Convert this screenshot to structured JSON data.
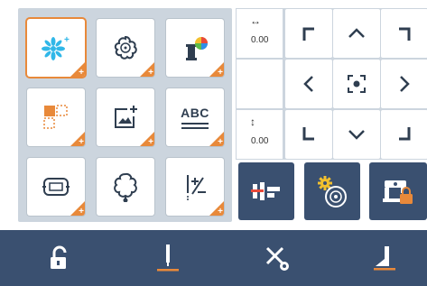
{
  "tools": [
    {
      "name": "embroidery-pattern-button",
      "icon": "sparkle-pattern-icon",
      "selected": true
    },
    {
      "name": "flower-frame-button",
      "icon": "flower-frame-icon"
    },
    {
      "name": "thread-color-button",
      "icon": "thread-color-icon"
    },
    {
      "name": "layout-select-button",
      "icon": "layout-select-icon"
    },
    {
      "name": "image-add-button",
      "icon": "image-add-icon"
    },
    {
      "name": "text-abc-button",
      "icon": "text-abc-icon",
      "label": "ABC"
    },
    {
      "name": "hoop-button",
      "icon": "hoop-icon"
    },
    {
      "name": "outline-shape-button",
      "icon": "outline-shape-icon"
    },
    {
      "name": "stitch-plus-minus-button",
      "icon": "stitch-plus-minus-icon"
    }
  ],
  "corner_symbol": "+",
  "position": {
    "horizontal_arrow": "↔",
    "horizontal_value": "0.00",
    "vertical_arrow": "↕",
    "vertical_value": "0.00"
  },
  "move_pad": {
    "up_left": "up-left-corner-icon",
    "up": "chevron-up-icon",
    "up_right": "up-right-corner-icon",
    "left": "chevron-left-icon",
    "center": "center-target-icon",
    "right": "chevron-right-icon",
    "down_left": "down-left-corner-icon",
    "down": "chevron-down-icon",
    "down_right": "down-right-corner-icon"
  },
  "modes": [
    {
      "name": "stitch-mode-button",
      "icon": "stitch-mode-icon",
      "active": true
    },
    {
      "name": "embroidery-settings-button",
      "icon": "settings-flower-icon"
    },
    {
      "name": "machine-lock-button",
      "icon": "machine-lock-icon"
    }
  ],
  "bottom_bar": [
    "unlock-icon",
    "needle-position-icon",
    "thread-cut-icon",
    "presser-foot-icon"
  ],
  "colors": {
    "accent": "#e8893a",
    "panel": "#ccd5de",
    "bar": "#3a5070",
    "icon_blue": "#2f3e50",
    "sparkle": "#30b7e8"
  }
}
